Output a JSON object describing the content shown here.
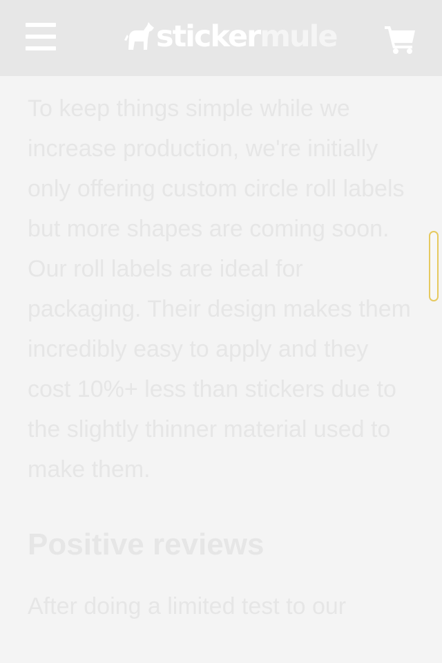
{
  "header": {
    "logo_text_bold": "sticker",
    "logo_text_light": "mule",
    "menu_icon": "hamburger-menu-icon",
    "logo_icon": "mule-logo-icon",
    "cart_icon": "shopping-cart-icon"
  },
  "article": {
    "intro_paragraph": "To keep things simple while we increase production, we're initially only offering custom circle roll labels but more shapes are coming soon. Our roll labels are ideal for packaging. Their design makes them incredibly easy to apply and they cost 10%+ less than stickers due to the slightly thinner material used to make them.",
    "section_heading": "Positive reviews",
    "section_paragraph": "After doing a limited test to our"
  },
  "colors": {
    "header_bg": "#e7e7e7",
    "page_bg": "#f4f4f4",
    "text": "#e6e6e6",
    "scroll_handle_border": "#e6c95e"
  }
}
